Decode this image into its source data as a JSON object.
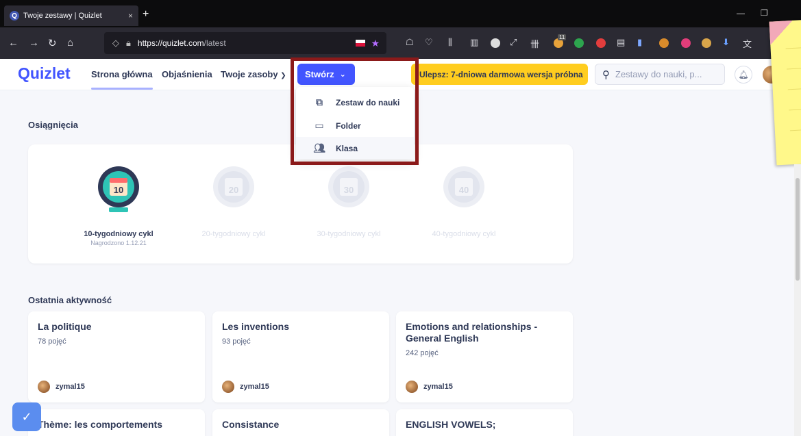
{
  "browser": {
    "tab_title": "Twoje zestawy | Quizlet",
    "url_host": "https://quizlet.com",
    "url_path": "/latest",
    "new_tab_glyph": "+",
    "close_glyph": "×"
  },
  "header": {
    "logo": "Quizlet",
    "nav": [
      "Strona główna",
      "Objaśnienia",
      "Twoje zasoby"
    ],
    "create_label": "Stwórz",
    "upgrade_label": "Ulepsz: 7-dniowa darmowa wersja próbna",
    "search_placeholder": "Zestawy do nauki, p..."
  },
  "dropdown": {
    "items": [
      {
        "label": "Zestaw do nauki",
        "icon": "copy-icon"
      },
      {
        "label": "Folder",
        "icon": "folder-icon"
      },
      {
        "label": "Klasa",
        "icon": "users-icon"
      }
    ]
  },
  "achievements": {
    "title": "Osiągnięcia",
    "items": [
      {
        "number": "10",
        "name": "10-tygodniowy cykl",
        "sub": "Nagrodzono 1.12.21",
        "earned": true
      },
      {
        "number": "20",
        "name": "20-tygodniowy cykl",
        "sub": "",
        "earned": false
      },
      {
        "number": "30",
        "name": "30-tygodniowy cykl",
        "sub": "",
        "earned": false
      },
      {
        "number": "40",
        "name": "40-tygodniowy cykl",
        "sub": "",
        "earned": false
      }
    ]
  },
  "activity": {
    "title": "Ostatnia aktywność",
    "sets": [
      {
        "title": "La politique",
        "count": "78 pojęć",
        "author": "zymal15"
      },
      {
        "title": "Les inventions",
        "count": "93 pojęć",
        "author": "zymal15"
      },
      {
        "title": "Emotions and relationships - General English",
        "count": "242 pojęć",
        "author": "zymal15"
      },
      {
        "title": "Thème: les comportements",
        "count": "",
        "author": ""
      },
      {
        "title": "Consistance",
        "count": "",
        "author": ""
      },
      {
        "title": "ENGLISH VOWELS;",
        "count": "",
        "author": ""
      }
    ]
  },
  "colors": {
    "brand": "#4255ff",
    "upgrade": "#ffcd1f",
    "highlight_box": "#8b1a1a",
    "medal_teal": "#2ec4b6",
    "medal_dark": "#2e3856"
  }
}
